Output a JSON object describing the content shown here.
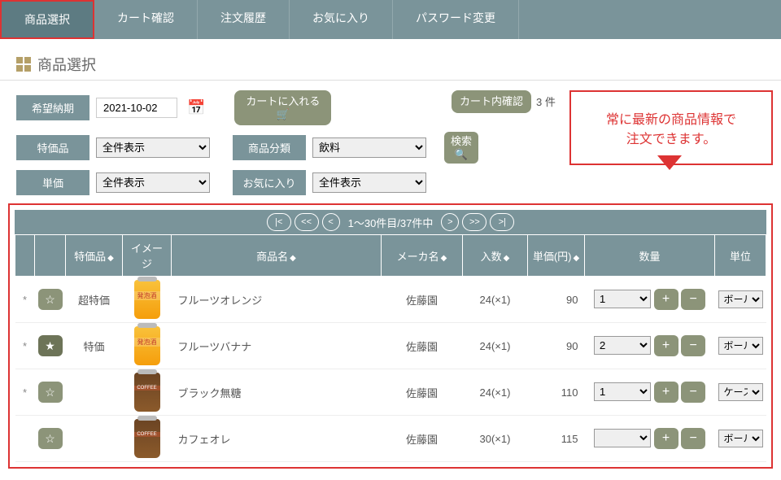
{
  "tabs": [
    "商品選択",
    "カート確認",
    "注文履歴",
    "お気に入り",
    "パスワード変更"
  ],
  "page_title": "商品選択",
  "filters": {
    "date_label": "希望納期",
    "date_value": "2021-10-02",
    "tokka_label": "特価品",
    "tokka_value": "全件表示",
    "tanka_label": "単価",
    "tanka_value": "全件表示",
    "bunrui_label": "商品分類",
    "bunrui_value": "飲料",
    "fav_label": "お気に入り",
    "fav_value": "全件表示"
  },
  "buttons": {
    "add_cart": "カートに入れる",
    "cart_check": "カート内確認",
    "search": "検索"
  },
  "cart_count_text": "3 件",
  "callout": "常に最新の商品情報で\n注文できます。",
  "pager": {
    "text": "1～30件目/37件中"
  },
  "headers": {
    "tokka": "特価品",
    "image": "イメージ",
    "name": "商品名",
    "maker": "メーカ名",
    "irisu": "入数",
    "tanka": "単価(円)",
    "qty": "数量",
    "unit": "単位"
  },
  "rows": [
    {
      "mark": "*",
      "fav": false,
      "tokka": "超特価",
      "img": "orange",
      "name": "フルーツオレンジ",
      "maker": "佐藤園",
      "irisu": "24(×1)",
      "price": "90",
      "qty": "1",
      "unit": "ボール"
    },
    {
      "mark": "*",
      "fav": true,
      "tokka": "特価",
      "img": "orange",
      "name": "フルーツバナナ",
      "maker": "佐藤園",
      "irisu": "24(×1)",
      "price": "90",
      "qty": "2",
      "unit": "ボール"
    },
    {
      "mark": "*",
      "fav": false,
      "tokka": "",
      "img": "coffee",
      "name": "ブラック無糖",
      "maker": "佐藤園",
      "irisu": "24(×1)",
      "price": "110",
      "qty": "1",
      "unit": "ケース"
    },
    {
      "mark": "",
      "fav": false,
      "tokka": "",
      "img": "coffee",
      "name": "カフェオレ",
      "maker": "佐藤園",
      "irisu": "30(×1)",
      "price": "115",
      "qty": "",
      "unit": "ボール"
    }
  ]
}
